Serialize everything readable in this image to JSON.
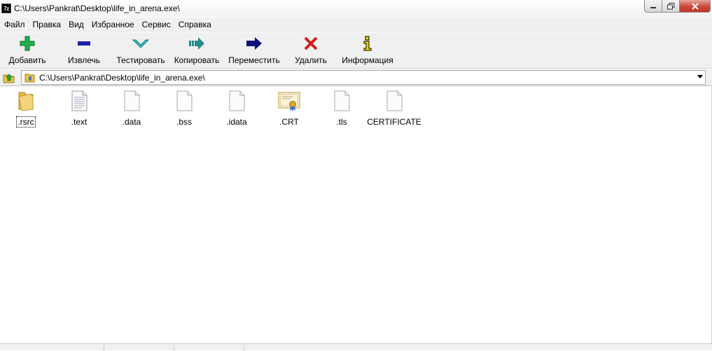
{
  "window": {
    "app_icon": "7z",
    "title": "C:\\Users\\Pankrat\\Desktop\\life_in_arena.exe\\"
  },
  "menu": {
    "items": [
      {
        "label": "Файл"
      },
      {
        "label": "Правка"
      },
      {
        "label": "Вид"
      },
      {
        "label": "Избранное"
      },
      {
        "label": "Сервис"
      },
      {
        "label": "Справка"
      }
    ]
  },
  "toolbar": {
    "add_label": "Добавить",
    "extract_label": "Извлечь",
    "test_label": "Тестировать",
    "copy_label": "Копировать",
    "move_label": "Переместить",
    "delete_label": "Удалить",
    "info_label": "Информация",
    "colors": {
      "add": "#22b14c",
      "extract": "#1e1ea8",
      "test": "#3cbfbf",
      "copy": "#2a8a8a",
      "move": "#10107a",
      "delete": "#d21c1c",
      "info": "#e8d800"
    }
  },
  "address": {
    "path": "C:\\Users\\Pankrat\\Desktop\\life_in_arena.exe\\"
  },
  "files": [
    {
      "name": ".rsrc",
      "icon": "folder-icon"
    },
    {
      "name": ".text",
      "icon": "text-file-icon"
    },
    {
      "name": ".data",
      "icon": "file-icon"
    },
    {
      "name": ".bss",
      "icon": "file-icon"
    },
    {
      "name": ".idata",
      "icon": "file-icon"
    },
    {
      "name": ".CRT",
      "icon": "certificate-icon"
    },
    {
      "name": ".tls",
      "icon": "file-icon"
    },
    {
      "name": "CERTIFICATE",
      "icon": "file-icon"
    }
  ]
}
